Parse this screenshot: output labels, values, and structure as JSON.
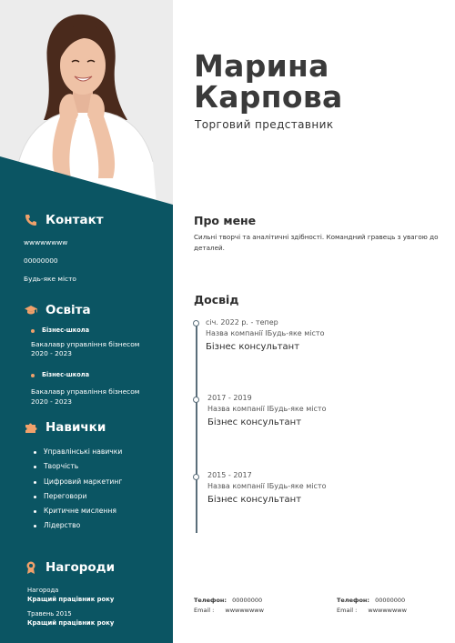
{
  "colors": {
    "sidebar": "#0b5563",
    "accent": "#f0a16b"
  },
  "header": {
    "name_first": "Марина",
    "name_last": "Карпова",
    "role": "Торговий представник"
  },
  "contact": {
    "heading": "Контакт",
    "icon": "phone-icon",
    "website": "wwwwwwww",
    "phone": "00000000",
    "address": "Будь-яке місто"
  },
  "education": {
    "heading": "Освіта",
    "icon": "graduation-cap-icon",
    "items": [
      {
        "school": "Бізнес-школа",
        "degree": "Бакалавр управління бізнесом",
        "years": "2020 - 2023"
      },
      {
        "school": "Бізнес-школа",
        "degree": "Бакалавр управління бізнесом",
        "years": "2020 - 2023"
      }
    ]
  },
  "skills": {
    "heading": "Навички",
    "icon": "puzzle-icon",
    "items": [
      "Управлінські навички",
      "Творчість",
      "Цифровий маркетинг",
      "Переговори",
      "Критичне мислення",
      "Лідерство"
    ]
  },
  "awards": {
    "heading": "Нагороди",
    "icon": "award-icon",
    "items": [
      {
        "label": "Нагорода",
        "title": "Кращий працівник року"
      },
      {
        "label": "Травень 2015",
        "title": "Кращий працівник року"
      }
    ]
  },
  "about": {
    "heading": "Про мене",
    "text": "Сильні творчі та аналітичні здібності. Командний гравець з увагою до деталей."
  },
  "experience": {
    "heading": "Досвід",
    "items": [
      {
        "date": "січ. 2022 р. - тепер",
        "company": "Назва компанії IБудь-яке місто",
        "title": "Бізнес консультант"
      },
      {
        "date": "2017 - 2019",
        "company": "Назва компанії IБудь-яке місто",
        "title": "Бізнес консультант"
      },
      {
        "date": "2015 - 2017",
        "company": "Назва компанії IБудь-яке місто",
        "title": "Бізнес консультант"
      }
    ]
  },
  "references": [
    {
      "phone_label": "Телефон:",
      "phone": "00000000",
      "email_label": "Email :",
      "email": "wwwwwwww"
    },
    {
      "phone_label": "Телефон:",
      "phone": "00000000",
      "email_label": "Email :",
      "email": "wwwwwwww"
    }
  ]
}
